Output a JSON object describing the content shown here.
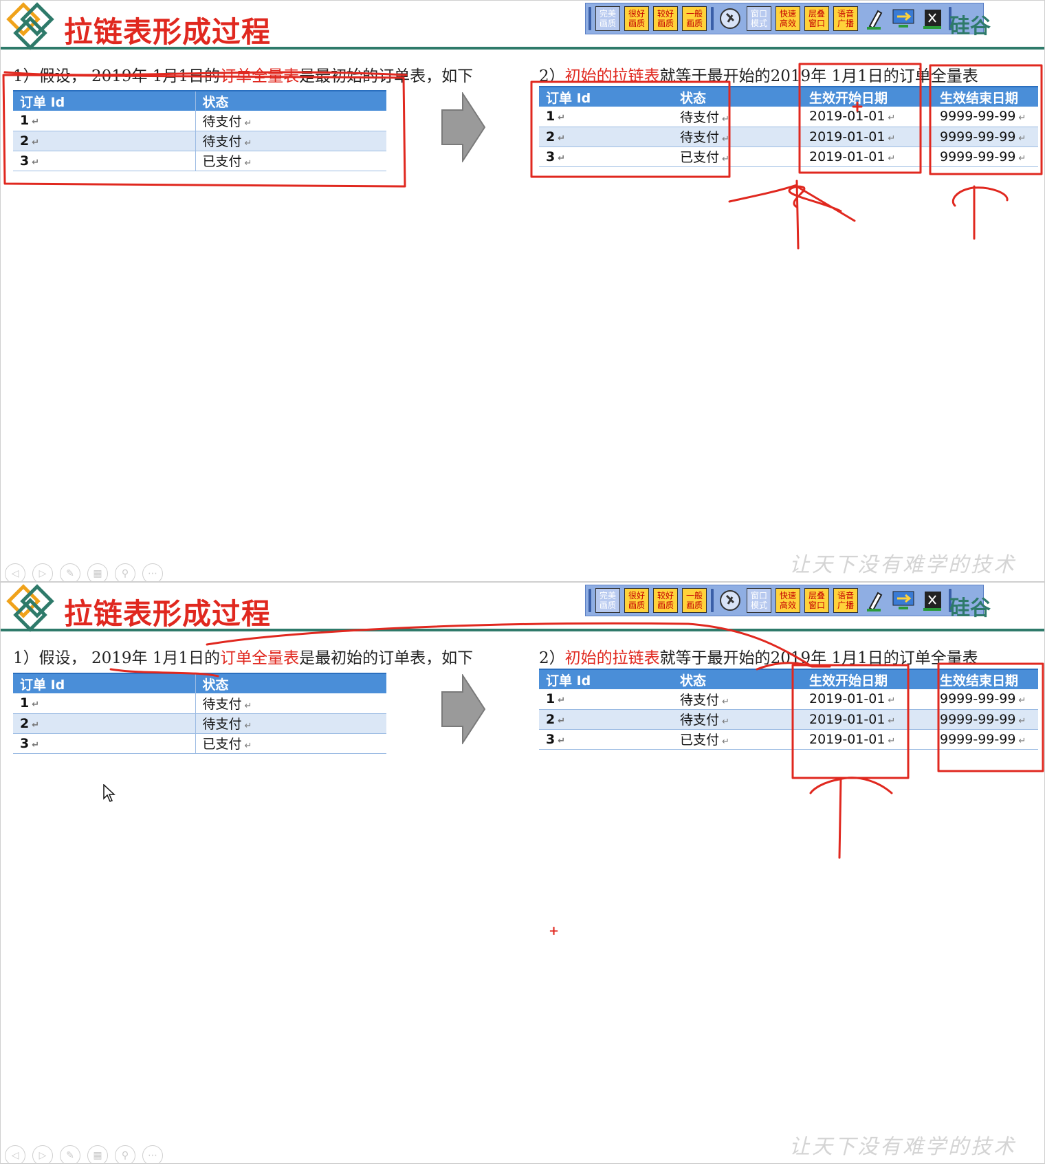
{
  "slides": [
    {
      "title": "拉链表形成过程",
      "step1": {
        "prefix": "1）假设，  2019年 1月1日的",
        "highlight": "订单全量表",
        "suffix": "是最初始的订单表，如下"
      },
      "step2": {
        "prefix": "2）",
        "highlight": "初始的拉链表",
        "suffix": "就等于最开始的2019年 1月1日的订单全量表"
      }
    },
    {
      "title": "拉链表形成过程",
      "step1": {
        "prefix": "1）假设，  2019年 1月1日的",
        "highlight": "订单全量表",
        "suffix": "是最初始的订单表，如下"
      },
      "step2": {
        "prefix": "2）",
        "highlight": "初始的拉链表",
        "suffix": "就等于最开始的2019年 1月1日的订单全量表"
      }
    }
  ],
  "table1": {
    "headers": [
      "订单 Id",
      "状态"
    ],
    "rows": [
      [
        "1",
        "待支付"
      ],
      [
        "2",
        "待支付"
      ],
      [
        "3",
        "已支付"
      ]
    ]
  },
  "table2": {
    "headers": [
      "订单 Id",
      "状态",
      "生效开始日期",
      "生效结束日期"
    ],
    "rows": [
      [
        "1",
        "待支付",
        "2019-01-01",
        "9999-99-99"
      ],
      [
        "2",
        "待支付",
        "2019-01-01",
        "9999-99-99"
      ],
      [
        "3",
        "已支付",
        "2019-01-01",
        "9999-99-99"
      ]
    ]
  },
  "toolbar": {
    "buttons": [
      {
        "label": "完美画质",
        "style": "blue"
      },
      {
        "label": "很好画质",
        "style": "red"
      },
      {
        "label": "较好画质",
        "style": "red"
      },
      {
        "label": "一般画质",
        "style": "red"
      },
      {
        "label": "窗口模式",
        "style": "blue"
      },
      {
        "label": "快速高效",
        "style": "red"
      },
      {
        "label": "层叠窗口",
        "style": "red"
      },
      {
        "label": "语音广播",
        "style": "red"
      }
    ]
  },
  "brand_text": "硅谷",
  "slogan": "让天下没有难学的技术",
  "return_mark": "↵",
  "colors": {
    "accent": "#e0281f",
    "rule": "#2e7a6a",
    "table_header": "#4a8ed8",
    "annotation": "#e0281f"
  }
}
